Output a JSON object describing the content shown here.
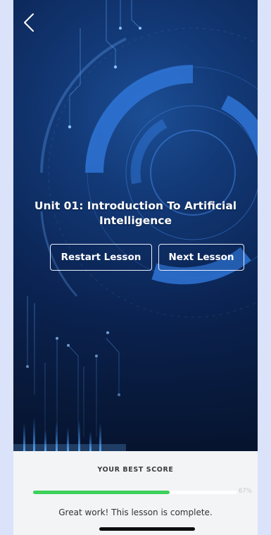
{
  "lesson": {
    "title": "Unit 01: Introduction To Artificial Intelligence"
  },
  "actions": {
    "restart_label": "Restart Lesson",
    "next_label": "Next Lesson"
  },
  "score": {
    "label": "YOUR BEST SCORE",
    "percent": 67,
    "percent_text": "67%",
    "message": "Great work! This lesson is complete."
  },
  "colors": {
    "hero_background": "#0b2452",
    "accent_blue": "#2f74d6",
    "progress_fill": "#3bd15a",
    "panel_background": "#f3f4f6"
  },
  "icons": {
    "back": "chevron-left-icon"
  }
}
